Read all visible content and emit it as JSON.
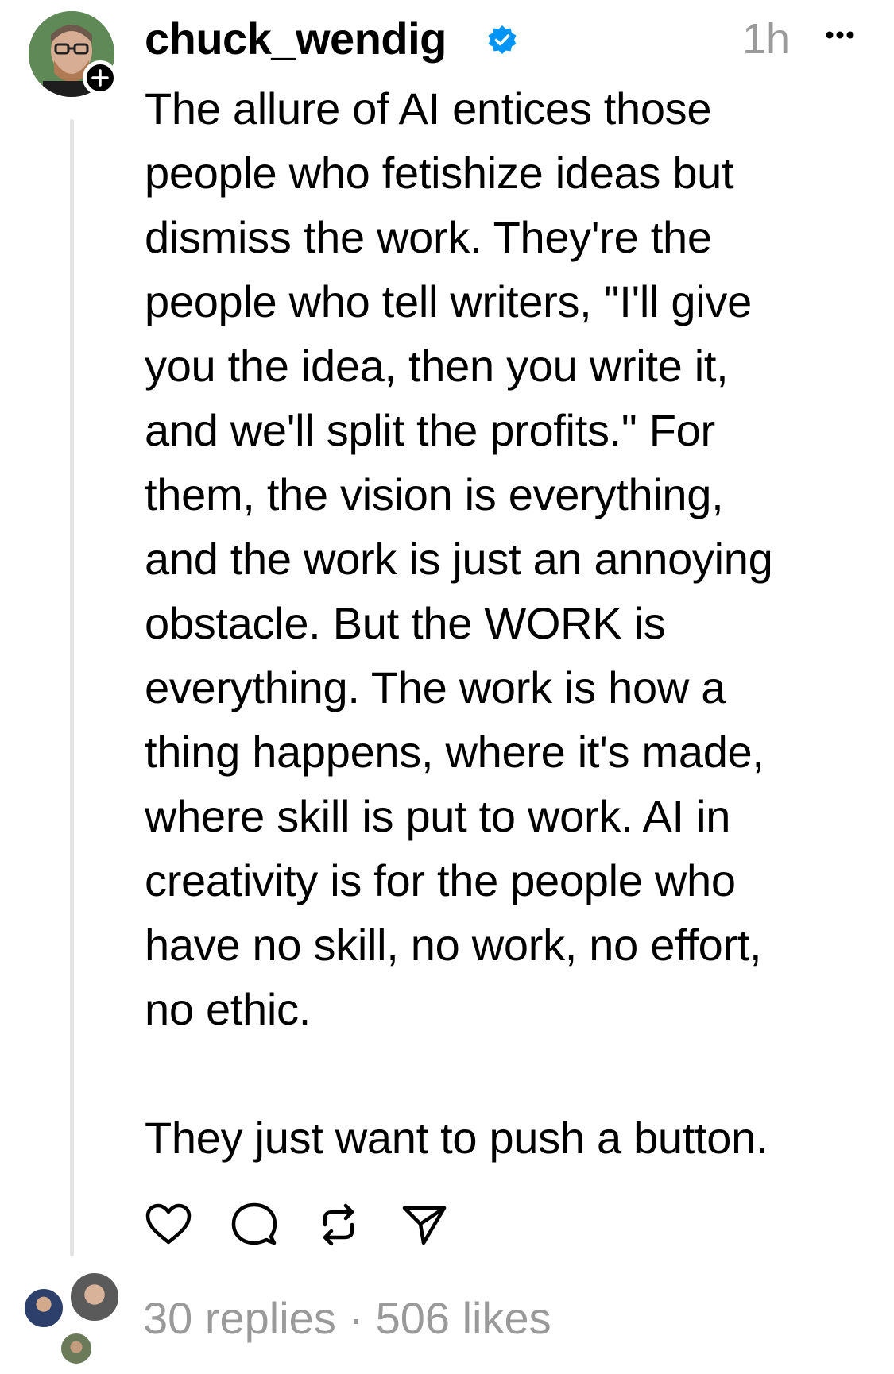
{
  "post": {
    "username": "chuck_wendig",
    "verified": true,
    "timestamp": "1h",
    "more_icon": "more-horizontal-icon",
    "body": "The allure of AI entices those\npeople who fetishize ideas but\ndismiss the work. They're the\npeople who tell writers, \"I'll give\nyou the idea, then you write it,\nand we'll split the profits.\" For\nthem, the vision is everything,\nand the work is just an annoying\nobstacle. But the WORK is\neverything. The work is how a\nthing happens, where it's made,\nwhere skill is put to work. AI in\ncreativity is for the people who\nhave no skill, no work, no effort,\nno ethic.\n\nThey just want to push a button.",
    "actions": [
      {
        "name": "like",
        "icon": "heart-icon"
      },
      {
        "name": "reply",
        "icon": "comment-icon"
      },
      {
        "name": "repost",
        "icon": "repost-icon"
      },
      {
        "name": "share",
        "icon": "send-icon"
      }
    ],
    "stats": "30 replies · 506 likes"
  },
  "colors": {
    "text": "#000000",
    "muted": "#9a9a9a",
    "verified_blue": "#0095f6",
    "thread_line": "#e3e3e3"
  }
}
